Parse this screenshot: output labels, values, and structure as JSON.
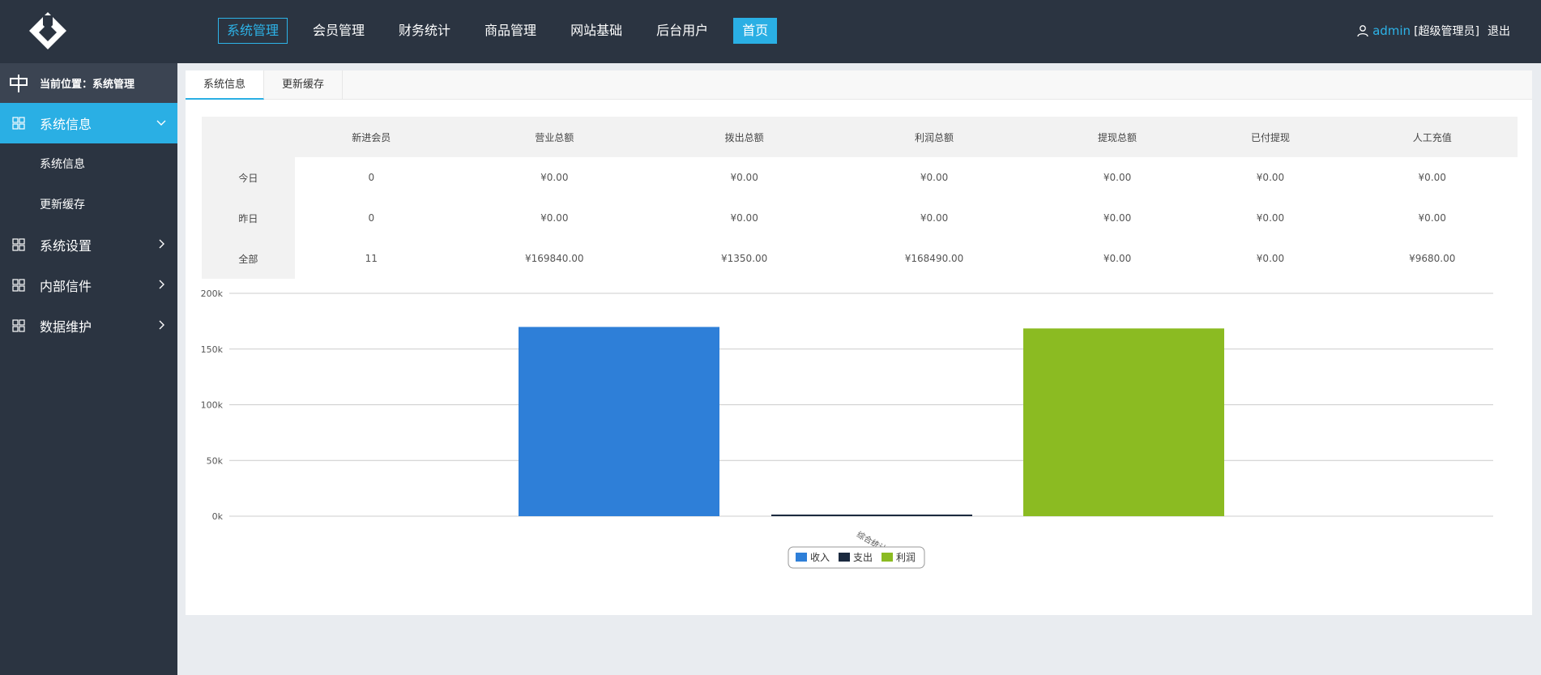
{
  "header": {
    "nav": [
      {
        "label": "系统管理",
        "state": "active"
      },
      {
        "label": "会员管理",
        "state": ""
      },
      {
        "label": "财务统计",
        "state": ""
      },
      {
        "label": "商品管理",
        "state": ""
      },
      {
        "label": "网站基础",
        "state": ""
      },
      {
        "label": "后台用户",
        "state": ""
      },
      {
        "label": "首页",
        "state": "home"
      }
    ],
    "user": {
      "name": "admin",
      "role": "[超级管理员]",
      "logout": "退出"
    }
  },
  "sidebar": {
    "location": "当前位置：系统管理",
    "items": [
      {
        "label": "系统信息",
        "active": true,
        "expanded": true,
        "children": [
          "系统信息",
          "更新缓存"
        ]
      },
      {
        "label": "系统设置",
        "active": false,
        "expanded": false
      },
      {
        "label": "内部信件",
        "active": false,
        "expanded": false
      },
      {
        "label": "数据维护",
        "active": false,
        "expanded": false
      }
    ]
  },
  "tabs": [
    "系统信息",
    "更新缓存"
  ],
  "stats": {
    "columns": [
      "",
      "新进会员",
      "营业总额",
      "拨出总额",
      "利润总额",
      "提现总额",
      "已付提现",
      "人工充值"
    ],
    "rows": [
      [
        "今日",
        "0",
        "¥0.00",
        "¥0.00",
        "¥0.00",
        "¥0.00",
        "¥0.00",
        "¥0.00"
      ],
      [
        "昨日",
        "0",
        "¥0.00",
        "¥0.00",
        "¥0.00",
        "¥0.00",
        "¥0.00",
        "¥0.00"
      ],
      [
        "全部",
        "11",
        "¥169840.00",
        "¥1350.00",
        "¥168490.00",
        "¥0.00",
        "¥0.00",
        "¥9680.00"
      ]
    ]
  },
  "chart_data": {
    "type": "bar",
    "categories": [
      "综合统计"
    ],
    "series": [
      {
        "name": "收入",
        "values": [
          169840
        ],
        "color": "#2e7fd8"
      },
      {
        "name": "支出",
        "values": [
          1350
        ],
        "color": "#1b2a3f"
      },
      {
        "name": "利润",
        "values": [
          168490
        ],
        "color": "#8bbb22"
      }
    ],
    "yticks": [
      "0k",
      "50k",
      "100k",
      "150k",
      "200k"
    ],
    "ylim": [
      0,
      200000
    ],
    "grid": true,
    "legend": "bottom-center"
  },
  "colors": {
    "dark": "#2b3441",
    "accent": "#2aafe4"
  }
}
